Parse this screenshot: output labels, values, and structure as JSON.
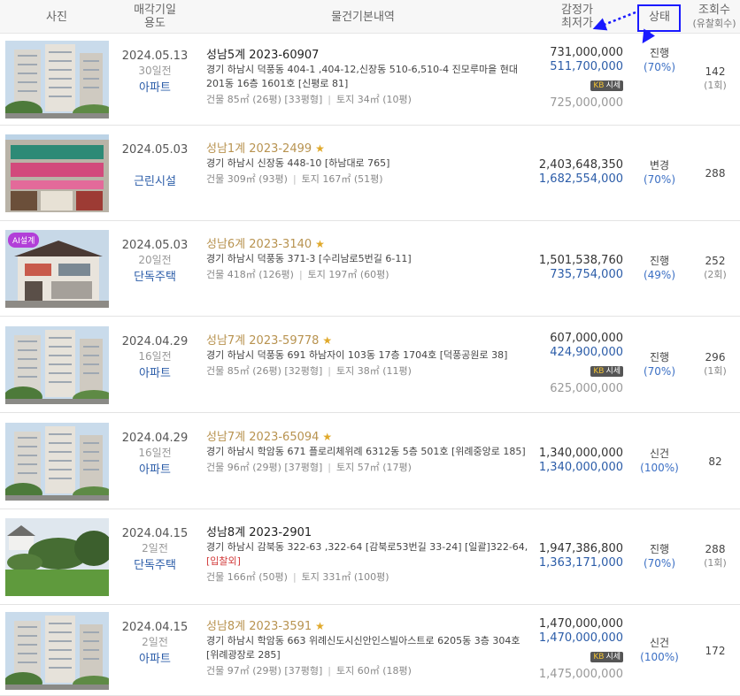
{
  "header": {
    "photo": "사진",
    "sale_date_line1": "매각기일",
    "sale_date_line2": "용도",
    "info": "물건기본내역",
    "price_line1": "감정가",
    "price_line2": "최저가",
    "status": "상태",
    "views_line1": "조회수",
    "views_line2": "(유찰회수)"
  },
  "market_label": "시세",
  "listings": [
    {
      "photo": "apartment-photo",
      "date": "2024.05.13",
      "days": "30일전",
      "type": "아파트",
      "case": "성남5계 2023-60907",
      "starred": false,
      "address": "경기 하남시 덕풍동 404-1 ,404-12,신장동 510-6,510-4 진모루마을 현대 201동 16층 1601호 [신평로 81]",
      "note": "",
      "area_building": "건물 85㎡ (26평) [33평형]",
      "area_land": "토지 34㎡ (10평)",
      "appraisal": "731,000,000",
      "minimum": "511,700,000",
      "has_market": true,
      "market": "725,000,000",
      "state": "진행",
      "pct": "(70%)",
      "views": "142",
      "fails": "(1회)"
    },
    {
      "photo": "commercial-building-photo",
      "date": "2024.05.03",
      "days": "",
      "type": "근린시설",
      "case": "성남1계 2023-2499",
      "starred": true,
      "address": "경기 하남시 신장동 448-10 [하남대로 765]",
      "note": "",
      "area_building": "건물 309㎡ (93평)",
      "area_land": "토지 167㎡ (51평)",
      "appraisal": "2,403,648,350",
      "minimum": "1,682,554,000",
      "has_market": false,
      "market": "",
      "state": "변경",
      "pct": "(70%)",
      "views": "288",
      "fails": ""
    },
    {
      "photo": "house-photo",
      "badge": "AI설계",
      "date": "2024.05.03",
      "days": "20일전",
      "type": "단독주택",
      "case": "성남6계 2023-3140",
      "starred": true,
      "address": "경기 하남시 덕풍동 371-3 [수리남로5번길 6-11]",
      "note": "",
      "area_building": "건물 418㎡ (126평)",
      "area_land": "토지 197㎡ (60평)",
      "appraisal": "1,501,538,760",
      "minimum": "735,754,000",
      "has_market": false,
      "market": "",
      "state": "진행",
      "pct": "(49%)",
      "views": "252",
      "fails": "(2회)"
    },
    {
      "photo": "apartment-photo",
      "date": "2024.04.29",
      "days": "16일전",
      "type": "아파트",
      "case": "성남7계 2023-59778",
      "starred": true,
      "address": "경기 하남시 덕풍동 691 하남자이 103동 17층 1704호 [덕풍공원로 38]",
      "note": "",
      "area_building": "건물 85㎡ (26평) [32평형]",
      "area_land": "토지 38㎡ (11평)",
      "appraisal": "607,000,000",
      "minimum": "424,900,000",
      "has_market": true,
      "market": "625,000,000",
      "state": "진행",
      "pct": "(70%)",
      "views": "296",
      "fails": "(1회)"
    },
    {
      "photo": "apartment-photo",
      "date": "2024.04.29",
      "days": "16일전",
      "type": "아파트",
      "case": "성남7계 2023-65094",
      "starred": true,
      "address": "경기 하남시 학암동 671 플로리체위례 6312동 5층 501호 [위례중앙로 185]",
      "note": "",
      "area_building": "건물 96㎡ (29평) [37평형]",
      "area_land": "토지 57㎡ (17평)",
      "appraisal": "1,340,000,000",
      "minimum": "1,340,000,000",
      "has_market": false,
      "market": "",
      "state": "신건",
      "pct": "(100%)",
      "views": "82",
      "fails": ""
    },
    {
      "photo": "house-garden-photo",
      "date": "2024.04.15",
      "days": "2일전",
      "type": "단독주택",
      "case": "성남8계 2023-2901",
      "starred": false,
      "address": "경기 하남시 감북동 322-63 ,322-64 [감북로53번길 33-24] [일괄]322-64,",
      "note": "[입찰외]",
      "area_building": "건물 166㎡ (50평)",
      "area_land": "토지 331㎡ (100평)",
      "appraisal": "1,947,386,800",
      "minimum": "1,363,171,000",
      "has_market": false,
      "market": "",
      "state": "진행",
      "pct": "(70%)",
      "views": "288",
      "fails": "(1회)"
    },
    {
      "photo": "apartment-photo",
      "date": "2024.04.15",
      "days": "2일전",
      "type": "아파트",
      "case": "성남8계 2023-3591",
      "starred": true,
      "address": "경기 하남시 학암동 663 위례신도시신안인스빌아스트로 6205동 3층 304호 [위례광장로 285]",
      "note": "",
      "area_building": "건물 97㎡ (29평) [37평형]",
      "area_land": "토지 60㎡ (18평)",
      "appraisal": "1,470,000,000",
      "minimum": "1,470,000,000",
      "has_market": true,
      "market": "1,475,000,000",
      "state": "신건",
      "pct": "(100%)",
      "views": "172",
      "fails": ""
    }
  ]
}
